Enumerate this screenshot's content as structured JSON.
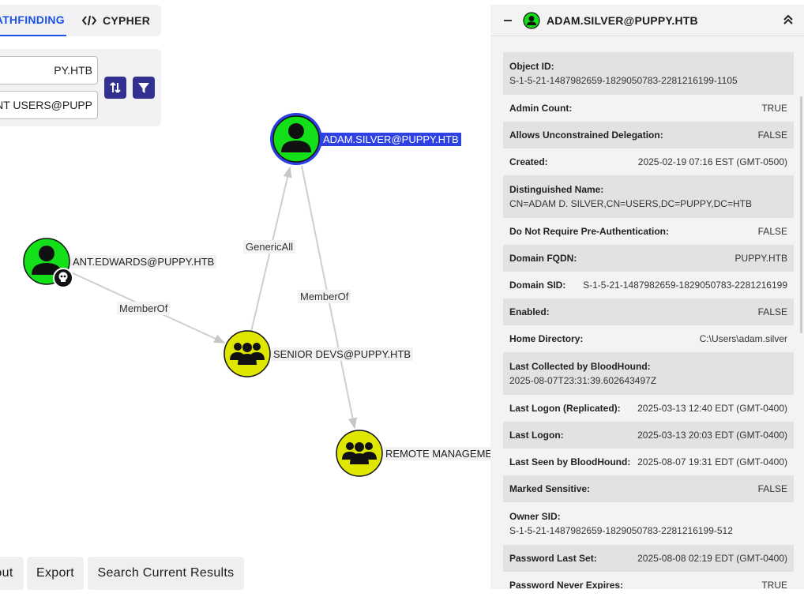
{
  "tabs": {
    "pathfinding": "ATHFINDING",
    "cypher": "CYPHER"
  },
  "search": {
    "start_value": "PY.HTB",
    "end_value": "NT USERS@PUPP"
  },
  "nodes": {
    "adam": "ADAM.SILVER@PUPPY.HTB",
    "ant": "ANT.EDWARDS@PUPPY.HTB",
    "senior": "SENIOR DEVS@PUPPY.HTB",
    "remote": "REMOTE MANAGEMEN"
  },
  "edges": {
    "generic_all": "GenericAll",
    "memberof_ant": "MemberOf",
    "memberof_adam": "MemberOf"
  },
  "bottom": {
    "layout": "out",
    "export": "Export",
    "search_results": "Search Current Results"
  },
  "panel": {
    "title": "ADAM.SILVER@PUPPY.HTB",
    "rows": [
      {
        "key": "Object ID:",
        "value": "S-1-5-21-1487982659-1829050783-2281216199-1105"
      },
      {
        "key": "Admin Count:",
        "value": "TRUE"
      },
      {
        "key": "Allows Unconstrained Delegation:",
        "value": "FALSE"
      },
      {
        "key": "Created:",
        "value": "2025-02-19 07:16 EST (GMT-0500)"
      },
      {
        "key": "Distinguished Name:",
        "value": "CN=ADAM D. SILVER,CN=USERS,DC=PUPPY,DC=HTB"
      },
      {
        "key": "Do Not Require Pre-Authentication:",
        "value": "FALSE"
      },
      {
        "key": "Domain FQDN:",
        "value": "PUPPY.HTB"
      },
      {
        "key": "Domain SID:",
        "value": "S-1-5-21-1487982659-1829050783-2281216199"
      },
      {
        "key": "Enabled:",
        "value": "FALSE"
      },
      {
        "key": "Home Directory:",
        "value": "C:\\Users\\adam.silver"
      },
      {
        "key": "Last Collected by BloodHound:",
        "value": "2025-08-07T23:31:39.602643497Z"
      },
      {
        "key": "Last Logon (Replicated):",
        "value": "2025-03-13 12:40 EDT (GMT-0400)"
      },
      {
        "key": "Last Logon:",
        "value": "2025-03-13 20:03 EDT (GMT-0400)"
      },
      {
        "key": "Last Seen by BloodHound:",
        "value": "2025-08-07 19:31 EDT (GMT-0400)"
      },
      {
        "key": "Marked Sensitive:",
        "value": "FALSE"
      },
      {
        "key": "Owner SID:",
        "value": "S-1-5-21-1487982659-1829050783-2281216199-512"
      },
      {
        "key": "Password Last Set:",
        "value": "2025-08-08 02:19 EDT (GMT-0400)"
      },
      {
        "key": "Password Never Expires:",
        "value": "TRUE"
      }
    ]
  }
}
